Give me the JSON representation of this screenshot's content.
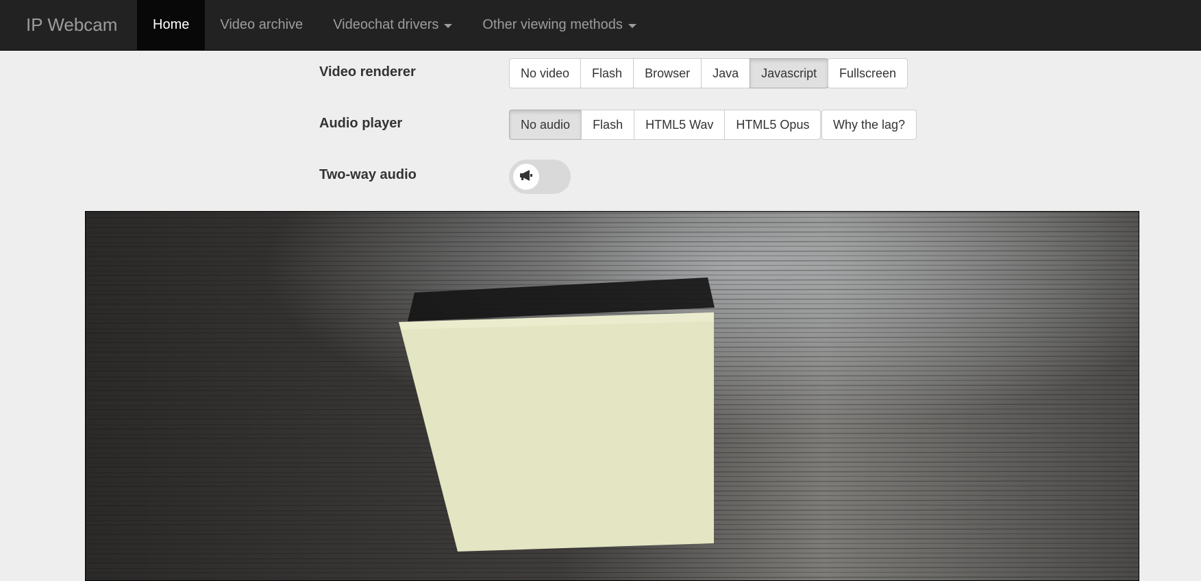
{
  "navbar": {
    "brand": "IP Webcam",
    "items": [
      {
        "label": "Home",
        "active": true,
        "dropdown": false
      },
      {
        "label": "Video archive",
        "active": false,
        "dropdown": false
      },
      {
        "label": "Videochat drivers",
        "active": false,
        "dropdown": true
      },
      {
        "label": "Other viewing methods",
        "active": false,
        "dropdown": true
      }
    ]
  },
  "video_renderer": {
    "label": "Video renderer",
    "options": [
      "No video",
      "Flash",
      "Browser",
      "Java",
      "Javascript"
    ],
    "selected": "Javascript",
    "fullscreen_label": "Fullscreen"
  },
  "audio_player": {
    "label": "Audio player",
    "options": [
      "No audio",
      "Flash",
      "HTML5 Wav",
      "HTML5 Opus"
    ],
    "selected": "No audio",
    "help_label": "Why the lag?"
  },
  "two_way_audio": {
    "label": "Two-way audio",
    "enabled": false,
    "icon": "megaphone-icon"
  },
  "colors": {
    "navbar_bg": "#222222",
    "active_nav_bg": "#080808",
    "page_bg": "#eeeeee",
    "note_color": "#e3e5c3"
  }
}
